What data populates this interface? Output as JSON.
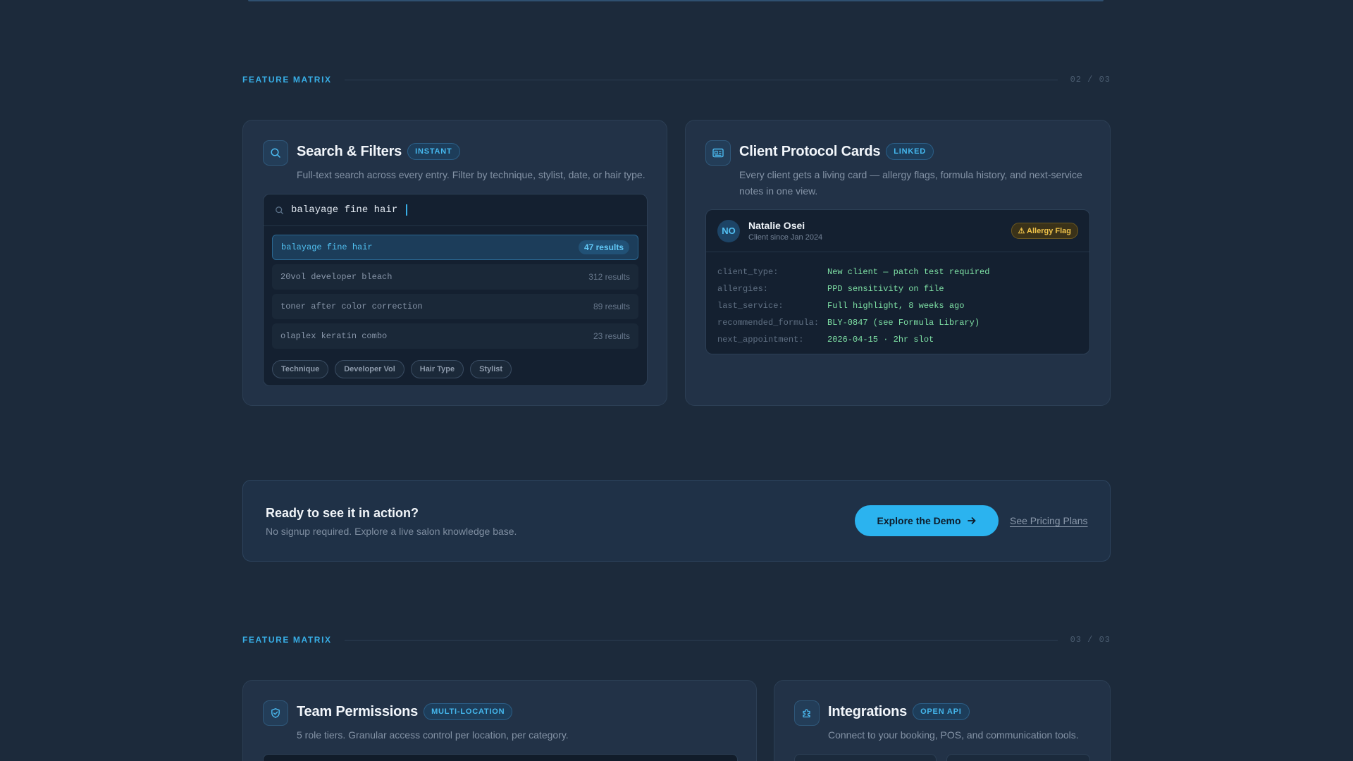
{
  "sections": [
    {
      "label": "FEATURE MATRIX",
      "count": "02 / 03"
    },
    {
      "label": "FEATURE MATRIX",
      "count": "03 / 03"
    }
  ],
  "search_card": {
    "icon": "search-icon",
    "title": "Search & Filters",
    "badge": "INSTANT",
    "description": "Full-text search across every entry. Filter by technique, stylist, date, or hair type.",
    "search": {
      "icon": "search-icon",
      "value": "balayage fine hair"
    },
    "results": [
      {
        "query": "balayage fine hair",
        "count": "47 results",
        "active": true
      },
      {
        "query": "20vol developer bleach",
        "count": "312 results",
        "active": false
      },
      {
        "query": "toner after color correction",
        "count": "89 results",
        "active": false
      },
      {
        "query": "olaplex keratin combo",
        "count": "23 results",
        "active": false
      }
    ],
    "chips": [
      "Technique",
      "Developer Vol",
      "Hair Type",
      "Stylist"
    ]
  },
  "client_card": {
    "icon": "id-card-icon",
    "title": "Client Protocol Cards",
    "badge": "LINKED",
    "description": "Every client gets a living card — allergy flags, formula history, and next-service notes in one view.",
    "client": {
      "initials": "NO",
      "name": "Natalie Osei",
      "since": "Client since Jan 2024",
      "flag": "⚠ Allergy Flag"
    },
    "fields": [
      {
        "key": "client_type:",
        "value": "New client — patch test required"
      },
      {
        "key": "allergies:",
        "value": "PPD sensitivity on file"
      },
      {
        "key": "last_service:",
        "value": "Full highlight, 8 weeks ago"
      },
      {
        "key": "recommended_formula:",
        "value": "BLY-0847 (see Formula Library)"
      },
      {
        "key": "next_appointment:",
        "value": "2026-04-15 · 2hr slot"
      }
    ]
  },
  "cta": {
    "title": "Ready to see it in action?",
    "subtitle": "No signup required. Explore a live salon knowledge base.",
    "primary": "Explore the Demo",
    "secondary": "See Pricing Plans"
  },
  "team_card": {
    "icon": "shield-check-icon",
    "title": "Team Permissions",
    "badge": "MULTI-LOCATION",
    "description": "5 role tiers. Granular access control per location, per category."
  },
  "integrations_card": {
    "icon": "puzzle-icon",
    "title": "Integrations",
    "badge": "OPEN API",
    "description": "Connect to your booking, POS, and communication tools."
  },
  "colors": {
    "accent": "#38aee6",
    "background": "#1c2a3b",
    "card": "#223247",
    "code_value": "#7ee0a4",
    "warning": "#f0c34a"
  }
}
